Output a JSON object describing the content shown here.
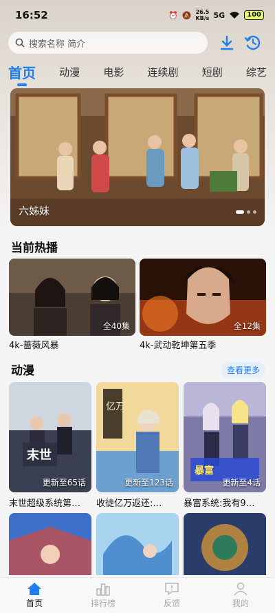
{
  "status": {
    "time": "16:52",
    "speed_value": "26.5",
    "speed_unit": "KB/s",
    "network": "5G",
    "battery": "100"
  },
  "search": {
    "placeholder": "搜索名称 简介"
  },
  "tabs": [
    {
      "label": "首页"
    },
    {
      "label": "动漫"
    },
    {
      "label": "电影"
    },
    {
      "label": "连续剧"
    },
    {
      "label": "短剧"
    },
    {
      "label": "综艺"
    }
  ],
  "banner": {
    "caption": "六姊妹"
  },
  "hot": {
    "title": "当前热播",
    "items": [
      {
        "title": "4k-蔷薇风暴",
        "badge": "全40集"
      },
      {
        "title": "4k-武动乾坤第五季",
        "badge": "全12集"
      }
    ]
  },
  "anime": {
    "title": "动漫",
    "more": "查看更多",
    "items": [
      {
        "title": "末世超级系统第…",
        "badge": "更新至65话"
      },
      {
        "title": "收徒亿万返还:…",
        "badge": "更新至123话"
      },
      {
        "title": "暴富系统:我有9…",
        "badge": "更新至4话"
      }
    ]
  },
  "bottom_nav": [
    {
      "label": "首页"
    },
    {
      "label": "排行榜"
    },
    {
      "label": "反馈"
    },
    {
      "label": "我的"
    }
  ],
  "colors": {
    "accent": "#1e7ef0"
  }
}
